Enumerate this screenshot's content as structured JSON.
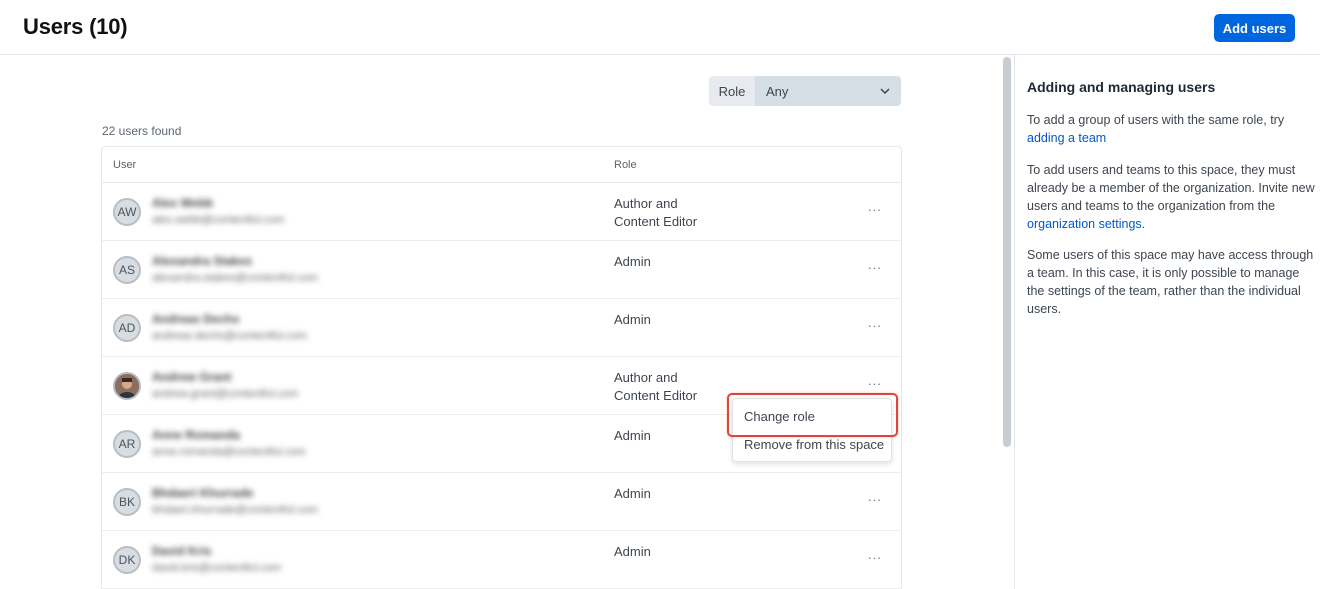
{
  "header": {
    "title": "Users (10)",
    "add_users_label": "Add users"
  },
  "filter": {
    "label": "Role",
    "value": "Any"
  },
  "users_found": "22 users found",
  "table": {
    "columns": [
      "User",
      "Role"
    ],
    "rows": [
      {
        "initials": "AW",
        "name": "Alex Webb",
        "email": "alex.webb@contentful.com",
        "role_line1": "Author and",
        "role_line2": "Content Editor",
        "menu": "..."
      },
      {
        "initials": "AS",
        "name": "Alexandra Stakes",
        "email": "alexandra.stakes@contentful.com",
        "role_line1": "Admin",
        "role_line2": "",
        "menu": "..."
      },
      {
        "initials": "AD",
        "name": "Andreas Dechs",
        "email": "andreas.dechs@contentful.com",
        "role_line1": "Admin",
        "role_line2": "",
        "menu": "..."
      },
      {
        "initials": "",
        "name": "Andrew Grant",
        "email": "andrew.grant@contentful.com",
        "role_line1": "Author and",
        "role_line2": "Content Editor",
        "menu": "..."
      },
      {
        "initials": "AR",
        "name": "Anne Romanda",
        "email": "anne.romanda@contentful.com",
        "role_line1": "Admin",
        "role_line2": "",
        "menu": "..."
      },
      {
        "initials": "BK",
        "name": "Bhdaeri Khurrade",
        "email": "bhdaeri.khurrade@contentful.com",
        "role_line1": "Admin",
        "role_line2": "",
        "menu": "..."
      },
      {
        "initials": "DK",
        "name": "David Kris",
        "email": "david.kris@contentful.com",
        "role_line1": "Admin",
        "role_line2": "",
        "menu": "..."
      }
    ]
  },
  "context_menu": {
    "change_role": "Change role",
    "remove": "Remove from this space"
  },
  "sidebar": {
    "title": "Adding and managing users",
    "p1_text": "To add a group of users with the same role, try",
    "p1_link": "adding a team",
    "p2_text": "To add users and teams to this space, they must already be a member of the organization. Invite new users and teams to the organization from the",
    "p2_link": "organization settings",
    "p2_end": ".",
    "p3_text": "Some users of this space may have access through a team. In this case, it is only possible to manage the settings of the team, rather than the individual users."
  },
  "colors": {
    "primary": "#0066e0",
    "highlight": "#e0453a",
    "link": "#0059c8"
  }
}
